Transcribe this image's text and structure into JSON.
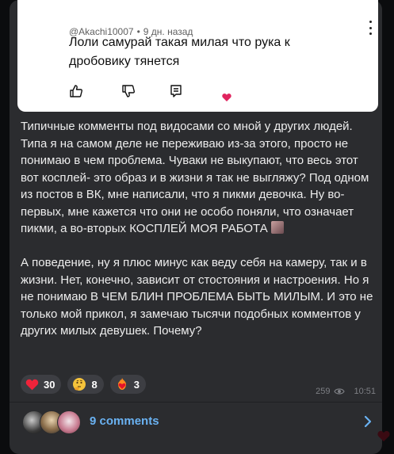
{
  "comment": {
    "author": "@Akachi10007",
    "time": "9 дн. назад",
    "text": "Лоли самурай такая милая что рука к дробовику тянется",
    "actions": [
      "like-icon",
      "dislike-icon",
      "reply-icon",
      "heart-icon"
    ]
  },
  "post": {
    "paragraph1": "Типичные комменты под видосами со мной у других людей. Типа я на самом деле не переживаю из-за этого, просто не понимаю в чем проблема. Чуваки не выкупают, что весь этот вот косплей- это образ и в жизни я так не выгляжу? Под одном из постов в ВК, мне написали, что я пикми девочка. Ну во-первых, мне кажется что они не особо поняли, что означает пикми, а во-вторых КОСПЛЕЙ МОЯ РАБОТА",
    "paragraph2": "А поведение, ну я плюс минус как веду себя на камеру, так и в жизни. Нет, конечно, зависит от стостояния и настроения. Но я не понимаю В ЧЕМ БЛИН ПРОБЛЕМА БЫТЬ МИЛЫМ. И это не только мой прикол, я замечаю тысячи подобных комментов у других милых девушек. Почему?",
    "reactions": [
      {
        "emoji": "red-heart",
        "count": "30"
      },
      {
        "emoji": "thinking-face",
        "count": "8"
      },
      {
        "emoji": "heart-on-fire",
        "count": "3"
      }
    ],
    "views": "259",
    "time": "10:51"
  },
  "comments_bar": {
    "label": "9 comments"
  },
  "colors": {
    "background": "#0b0c0e",
    "bubble": "#2b2c2f",
    "link": "#6ab2f2",
    "heart": "#e0245e"
  }
}
